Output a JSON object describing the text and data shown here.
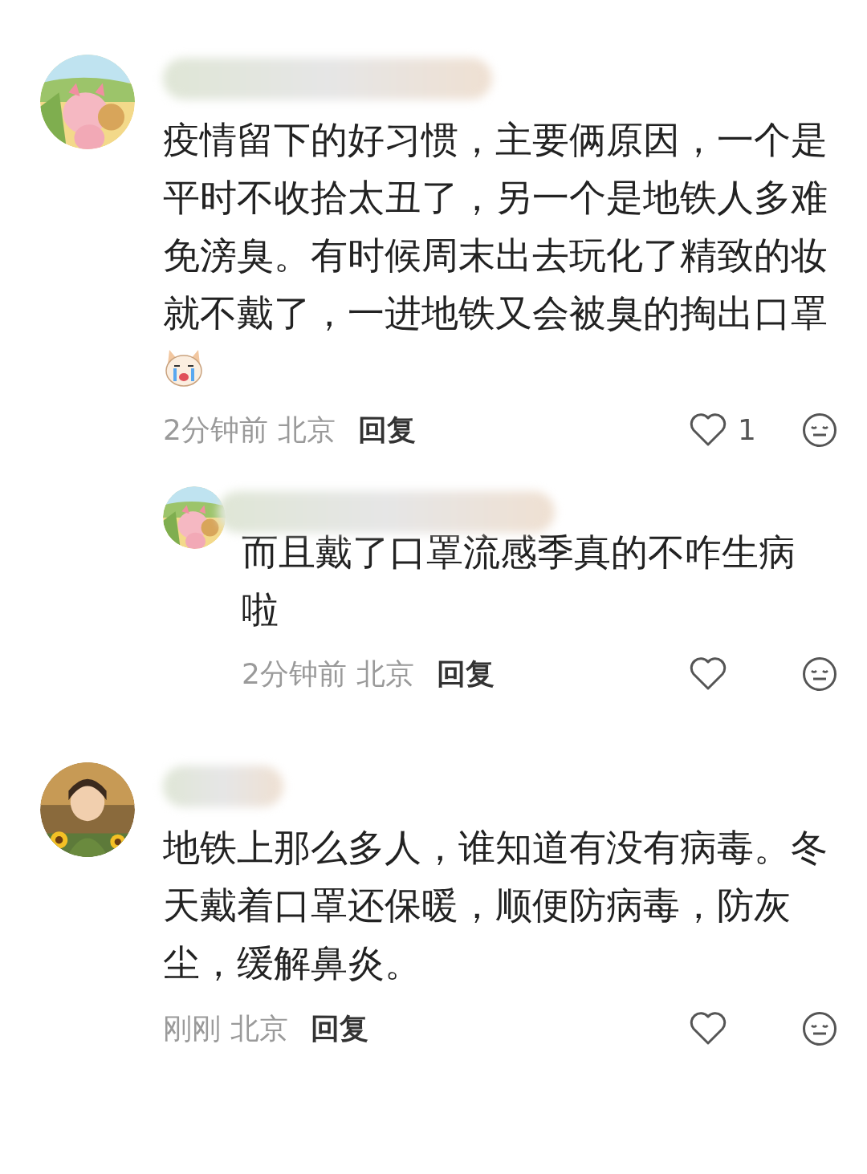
{
  "comments": [
    {
      "text": "疫情留下的好习惯，主要俩原因，一个是平时不收拾太丑了，另一个是地铁人多难免滂臭。有时候周末出去玩化了精致的妆就不戴了，一进地铁又会被臭的掏出口罩",
      "sticker": true,
      "time": "2分钟前",
      "location": "北京",
      "reply_label": "回复",
      "like_count": "1",
      "liked": false,
      "replies": [
        {
          "text": "而且戴了口罩流感季真的不咋生病啦",
          "time": "2分钟前",
          "location": "北京",
          "reply_label": "回复",
          "liked": false
        }
      ]
    },
    {
      "text": "地铁上那么多人，谁知道有没有病毒。冬天戴着口罩还保暖，顺便防病毒，防灰尘，缓解鼻炎。",
      "sticker": false,
      "time": "刚刚",
      "location": "北京",
      "reply_label": "回复",
      "liked": false
    }
  ]
}
